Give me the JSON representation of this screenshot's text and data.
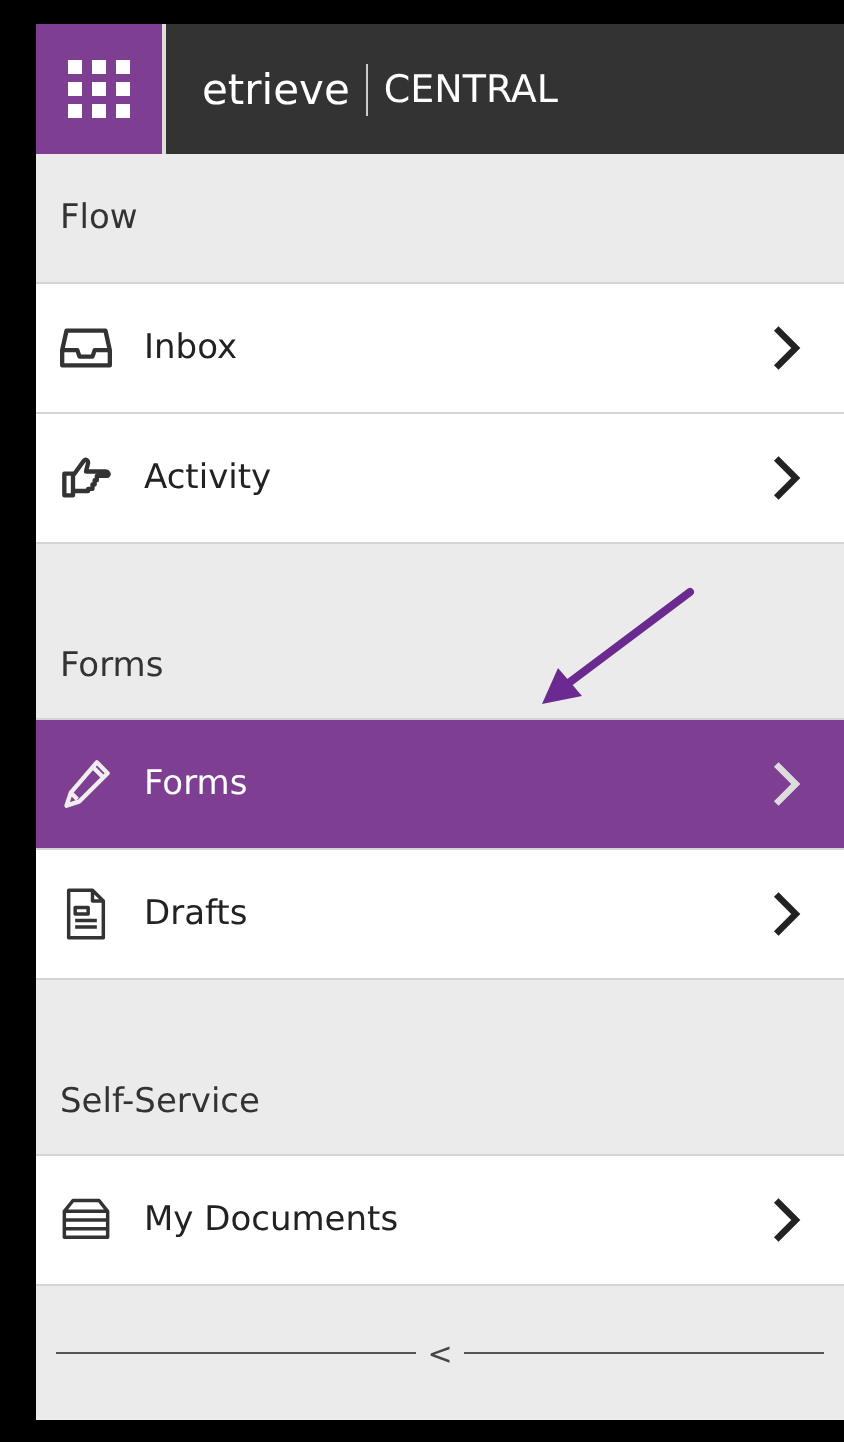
{
  "header": {
    "logo": "etrieve",
    "product": "CENTRAL"
  },
  "sections": [
    {
      "title": "Flow",
      "items": [
        {
          "label": "Inbox",
          "selected": false
        },
        {
          "label": "Activity",
          "selected": false
        }
      ]
    },
    {
      "title": "Forms",
      "items": [
        {
          "label": "Forms",
          "selected": true
        },
        {
          "label": "Drafts",
          "selected": false
        }
      ]
    },
    {
      "title": "Self-Service",
      "items": [
        {
          "label": "My Documents",
          "selected": false
        }
      ]
    }
  ],
  "collapse": {
    "symbol": "<"
  }
}
